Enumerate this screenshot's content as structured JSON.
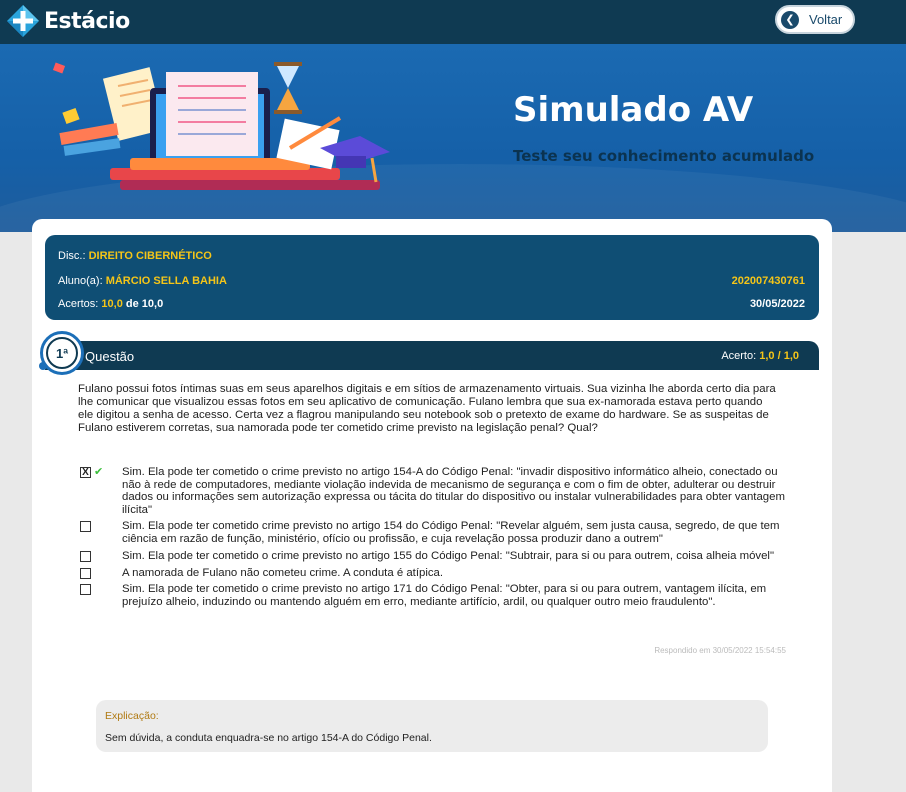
{
  "header": {
    "brand": "Estácio",
    "back_label": "Voltar"
  },
  "hero": {
    "title": "Simulado AV",
    "subtitle": "Teste seu conhecimento acumulado"
  },
  "info": {
    "disc_label": "Disc.:",
    "disc_value": "DIREITO CIBERNÉTICO",
    "aluno_label": "Aluno(a):",
    "aluno_value": "MÁRCIO SELLA BAHIA",
    "matricula": "202007430761",
    "acertos_label": "Acertos:",
    "acertos_value": "10,0",
    "acertos_total": "de 10,0",
    "date": "30/05/2022"
  },
  "question": {
    "number": "1ª",
    "label": "Questão",
    "score_label": "Acerto:",
    "score_value": "1,0",
    "score_total": "/ 1,0",
    "text": "Fulano possui fotos íntimas suas em seus aparelhos digitais e em sítios de armazenamento virtuais. Sua vizinha lhe aborda certo dia para lhe comunicar que visualizou essas fotos em seu aplicativo de comunicação. Fulano lembra que sua ex-namorada estava perto quando ele digitou a senha de acesso. Certa vez a flagrou manipulando seu notebook sob o pretexto de exame do hardware. Se as suspeitas de Fulano estiverem corretas, sua namorada pode ter cometido crime previsto na legislação penal? Qual?",
    "options": [
      {
        "text": "Sim. Ela pode ter cometido o crime previsto no artigo 154-A do Código Penal: \"invadir dispositivo informático alheio, conectado ou não à rede de computadores, mediante violação indevida de mecanismo de segurança e com o fim de obter, adulterar ou destruir dados ou informações sem autorização expressa ou tácita do titular do dispositivo ou instalar vulnerabilidades para obter vantagem ilícita\"",
        "mark": "X",
        "check": "✔"
      },
      {
        "text": "Sim. Ela pode ter cometido crime previsto no artigo 154 do Código Penal: \"Revelar alguém, sem justa causa, segredo, de que tem ciência em razão de função, ministério, ofício ou profissão, e cuja revelação possa produzir dano a outrem\"",
        "mark": "",
        "check": ""
      },
      {
        "text": "Sim. Ela pode ter cometido o crime previsto no artigo 155 do Código Penal: \"Subtrair, para si ou para outrem, coisa alheia móvel\"",
        "mark": "",
        "check": ""
      },
      {
        "text": "A namorada de Fulano não cometeu crime. A conduta é atípica.",
        "mark": "",
        "check": ""
      },
      {
        "text": "Sim. Ela pode ter cometido o crime previsto no artigo 171 do Código Penal: \"Obter, para si ou para outrem, vantagem ilícita, em prejuízo alheio, induzindo ou mantendo alguém em erro, mediante artifício, ardil, ou qualquer outro meio fraudulento\".",
        "mark": "",
        "check": ""
      }
    ],
    "answered_at": "Respondido em 30/05/2022 15:54:55"
  },
  "explanation": {
    "title": "Explicação:",
    "body": "Sem dúvida, a conduta enquadra-se no artigo 154-A do Código Penal."
  }
}
